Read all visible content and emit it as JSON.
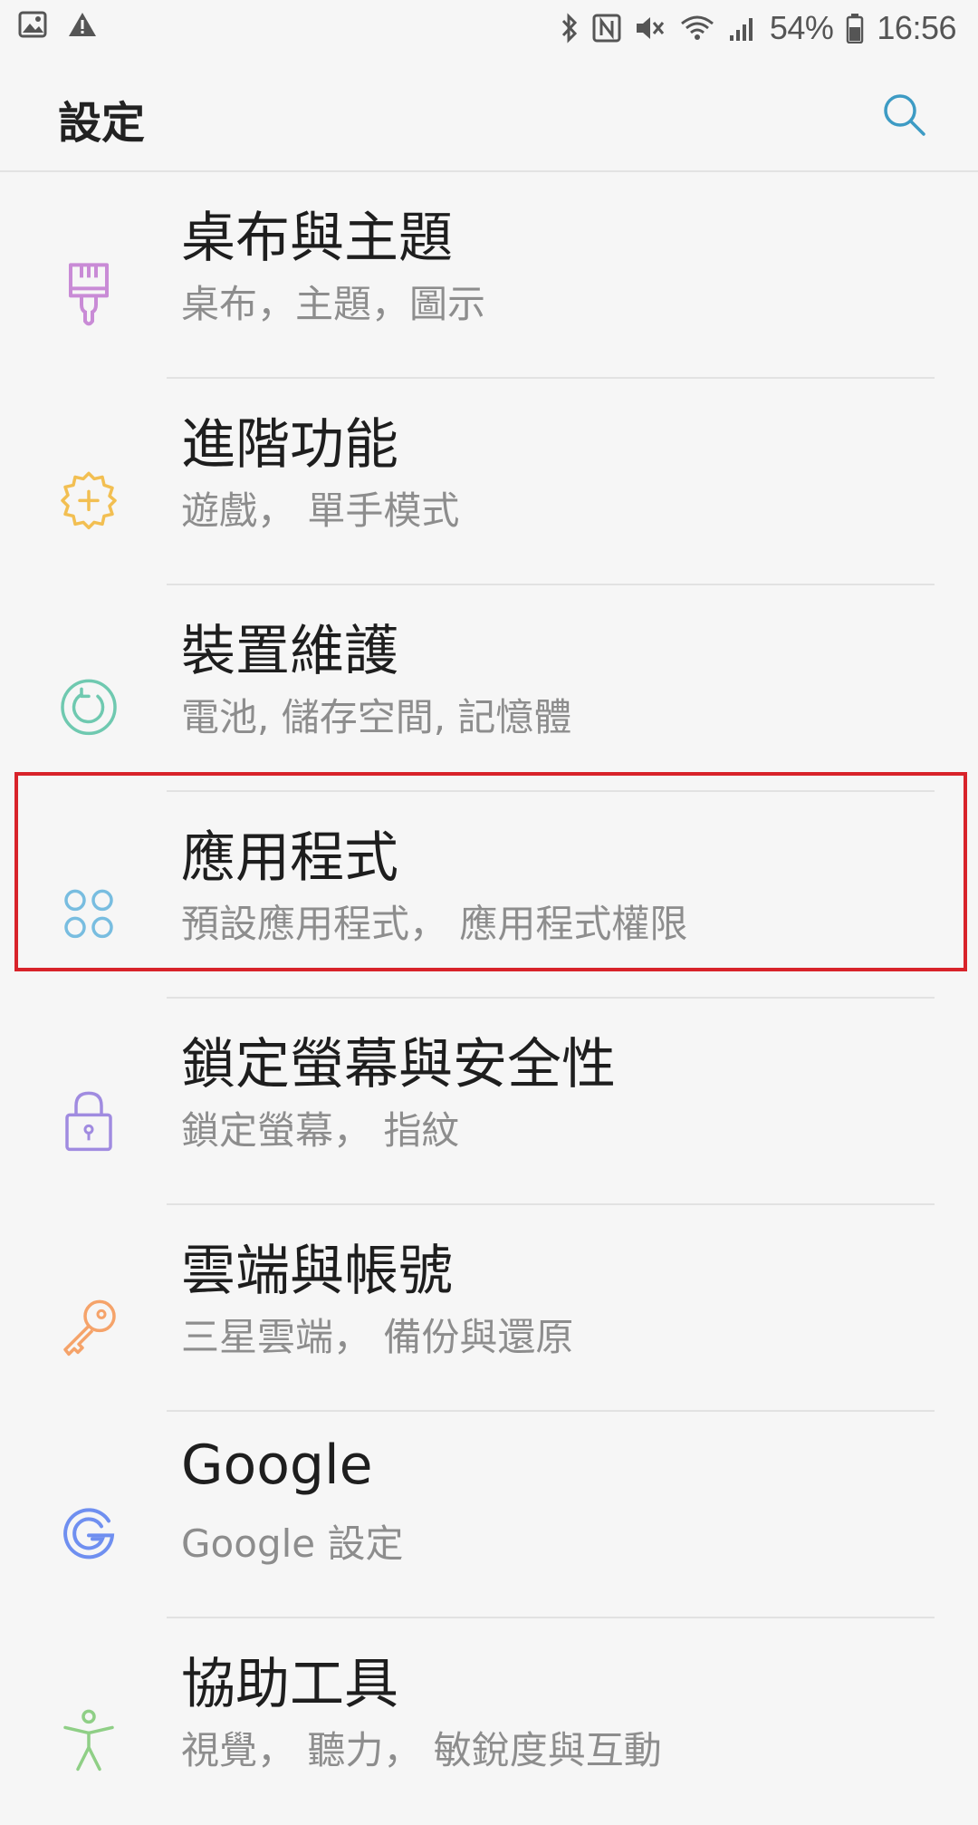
{
  "status_bar": {
    "battery": "54%",
    "time": "16:56",
    "left_icons": [
      "image-icon",
      "warning-icon"
    ],
    "right_icons": [
      "bluetooth-icon",
      "nfc-icon",
      "mute-icon",
      "wifi-icon",
      "signal-icon",
      "battery-icon"
    ]
  },
  "header": {
    "title": "設定",
    "search_icon": "search-icon"
  },
  "settings": {
    "items": [
      {
        "title": "桌布與主題",
        "subtitle": "桌布，主題，圖示",
        "icon": "paintbrush-icon",
        "icon_color": "#c98bd6"
      },
      {
        "title": "進階功能",
        "subtitle": "遊戲， 單手模式",
        "icon": "gear-plus-icon",
        "icon_color": "#f2bf52"
      },
      {
        "title": "裝置維護",
        "subtitle": "電池, 儲存空間, 記憶體",
        "icon": "device-care-icon",
        "icon_color": "#6fc9b0"
      },
      {
        "title": "應用程式",
        "subtitle": "預設應用程式， 應用程式權限",
        "icon": "apps-icon",
        "icon_color": "#78bde0"
      },
      {
        "title": "鎖定螢幕與安全性",
        "subtitle": "鎖定螢幕， 指紋",
        "icon": "lock-icon",
        "icon_color": "#a08be0"
      },
      {
        "title": "雲端與帳號",
        "subtitle": "三星雲端， 備份與還原",
        "icon": "key-icon",
        "icon_color": "#f5a36a"
      },
      {
        "title": "Google",
        "subtitle": "Google 設定",
        "icon": "google-icon",
        "icon_color": "#6f8ff0"
      },
      {
        "title": "協助工具",
        "subtitle": "視覺， 聽力， 敏銳度與互動",
        "icon": "accessibility-icon",
        "icon_color": "#8fcf86"
      }
    ]
  },
  "colors": {
    "background": "#f6f6f6",
    "highlight": "#d8232a",
    "accent": "#3d9bc4"
  }
}
